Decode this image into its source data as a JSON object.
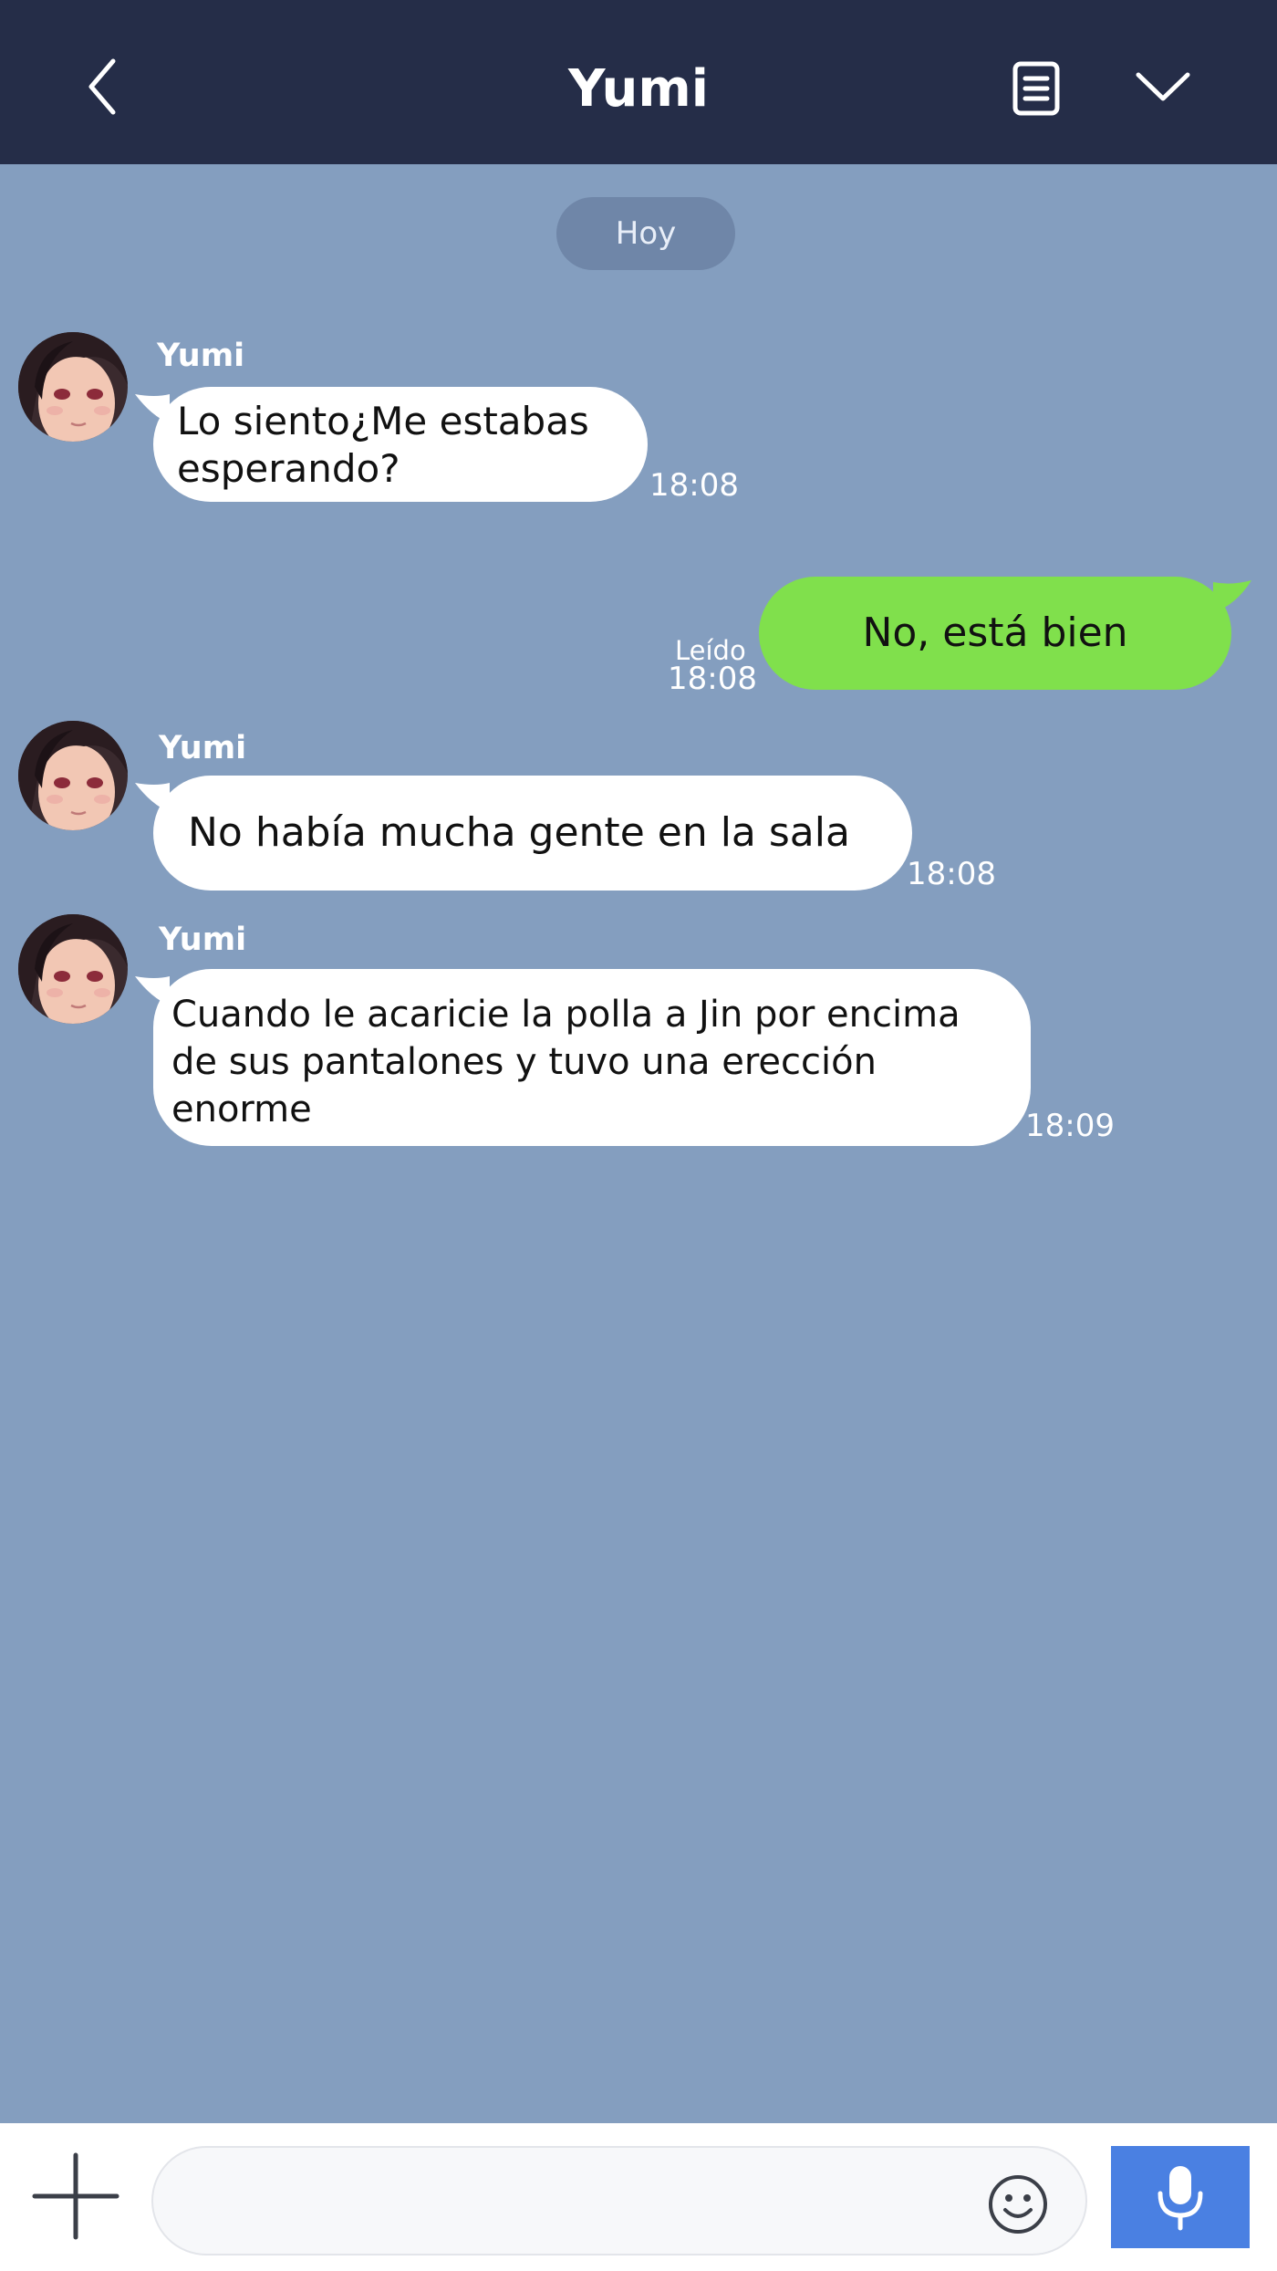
{
  "header": {
    "title": "Yumi",
    "back_icon": "chevron-left-icon",
    "notes_icon": "notes-icon",
    "menu_icon": "chevron-down-icon"
  },
  "date_separator": "Hoy",
  "messages": [
    {
      "direction": "incoming",
      "sender": "Yumi",
      "lines": [
        "Lo siento¿Me estabas",
        "esperando?"
      ],
      "time": "18:08"
    },
    {
      "direction": "outgoing",
      "text": "No, está bien",
      "status": "Leído",
      "time": "18:08"
    },
    {
      "direction": "incoming",
      "sender": "Yumi",
      "lines": [
        "No había mucha gente en la sala"
      ],
      "time": "18:08"
    },
    {
      "direction": "incoming",
      "sender": "Yumi",
      "lines": [
        "Cuando le acaricie la polla a Jin por encima",
        "de sus pantalones y tuvo una erección",
        "enorme"
      ],
      "time": "18:09"
    }
  ],
  "input": {
    "value": "",
    "placeholder": "",
    "plus_icon": "plus-icon",
    "emoji_icon": "emoji-icon",
    "mic_icon": "microphone-icon"
  },
  "colors": {
    "header_bg": "#252d48",
    "chat_bg": "#849ebf",
    "incoming_bubble": "#ffffff",
    "outgoing_bubble": "#80e04c",
    "mic_button": "#4a80e2"
  }
}
